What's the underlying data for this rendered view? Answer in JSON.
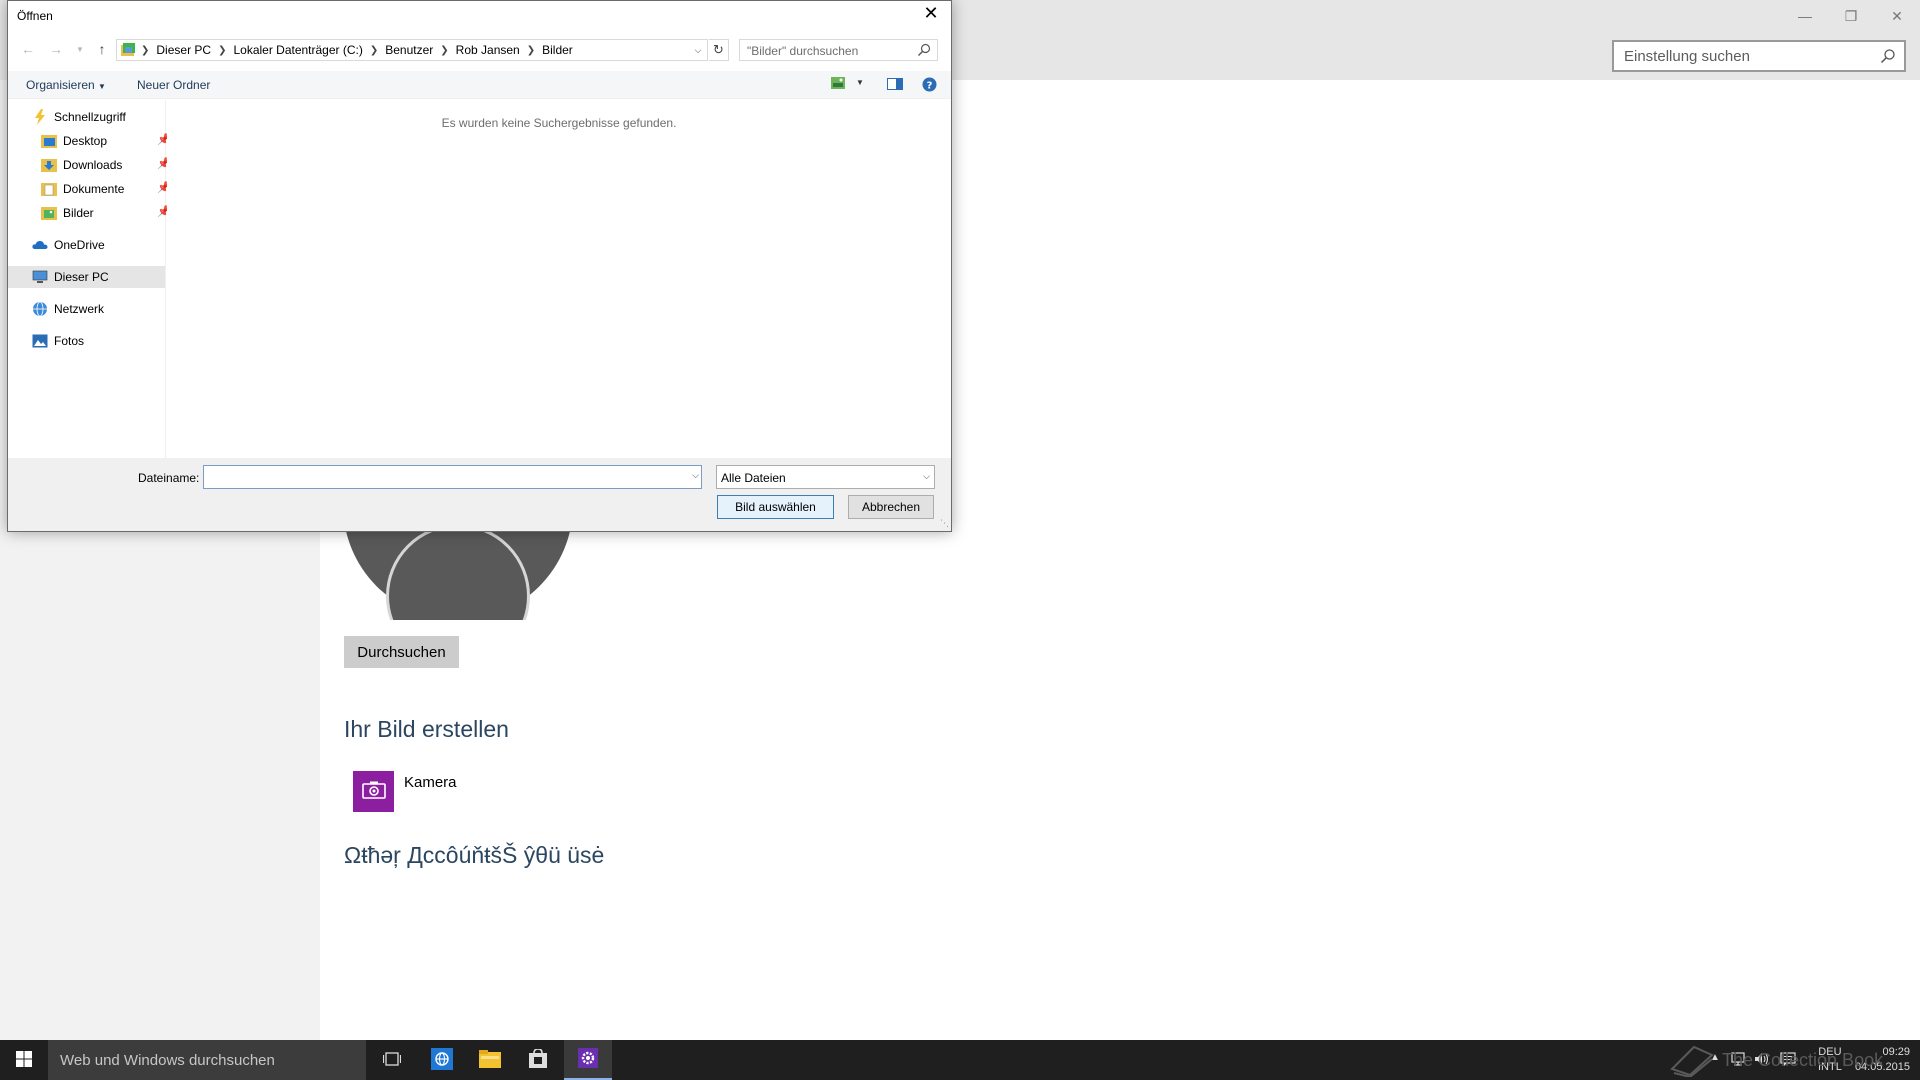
{
  "settings": {
    "search_placeholder": "Einstellung suchen",
    "browse_label": "Durchsuchen",
    "create_heading": "Ihr Bild erstellen",
    "camera_label": "Kamera",
    "other_heading": "Ωŧħəŗ ДccôúňŧšŠ ŷθü üsė"
  },
  "dialog": {
    "title": "Öffnen",
    "breadcrumb": [
      "Dieser PC",
      "Lokaler Datenträger (C:)",
      "Benutzer",
      "Rob Jansen",
      "Bilder"
    ],
    "search_placeholder": "\"Bilder\" durchsuchen",
    "toolbar": {
      "organize": "Organisieren",
      "new_folder": "Neuer Ordner"
    },
    "nav": {
      "quick_access": "Schnellzugriff",
      "desktop": "Desktop",
      "downloads": "Downloads",
      "documents": "Dokumente",
      "pictures": "Bilder",
      "onedrive": "OneDrive",
      "this_pc": "Dieser PC",
      "network": "Netzwerk",
      "photos": "Fotos"
    },
    "empty_message": "Es wurden keine Suchergebnisse gefunden.",
    "filename_label": "Dateiname:",
    "filename_value": "",
    "filetype_value": "Alle Dateien",
    "ok_label": "Bild auswählen",
    "cancel_label": "Abbrechen"
  },
  "taskbar": {
    "search_placeholder": "Web und Windows durchsuchen",
    "lang_line1": "DEU",
    "lang_line2": "INTL",
    "time": "09:29",
    "date": "04.05.2015",
    "watermark": "The Collection Book"
  },
  "colors": {
    "accent_purple": "#8c1fa0",
    "heading_blue": "#2b4660",
    "taskbar": "#1f1f1f"
  }
}
